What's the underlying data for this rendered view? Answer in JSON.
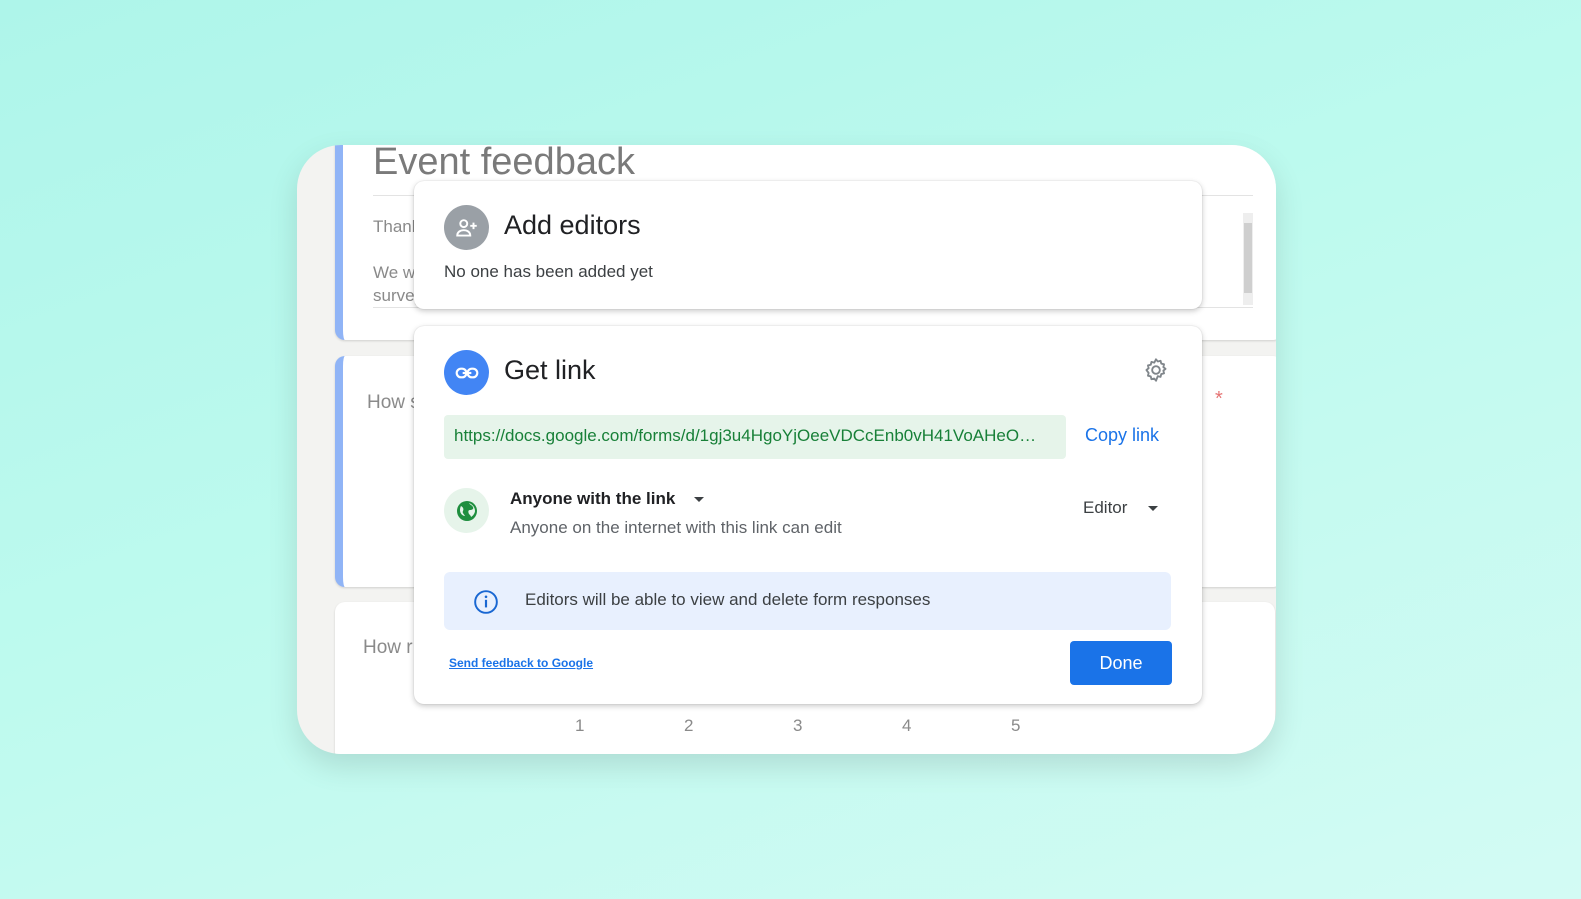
{
  "form": {
    "title": "Event feedback",
    "desc_line1": "Thank",
    "desc_line2a": "We wa",
    "desc_line2b": "survey",
    "question1": "How s",
    "question1_required": "*",
    "question2": "How r",
    "scale": [
      "1",
      "2",
      "3",
      "4",
      "5"
    ]
  },
  "add_editors": {
    "title": "Add editors",
    "subtitle": "No one has been added yet",
    "icon": "person-add-icon"
  },
  "get_link": {
    "title": "Get link",
    "icon": "link-icon",
    "settings_icon": "gear-icon",
    "url": "https://docs.google.com/forms/d/1gj3u4HgoYjOeeVDCcEnb0vH41VoAHeO…",
    "copy_label": "Copy link",
    "access_label": "Anyone with the link",
    "access_desc": "Anyone on the internet with this link can edit",
    "role_label": "Editor",
    "info_text": "Editors will be able to view and delete form responses",
    "feedback_label": "Send feedback to Google",
    "done_label": "Done"
  },
  "colors": {
    "accent": "#1a73e8",
    "link_green": "#188038",
    "link_bg": "#e6f4ea",
    "info_bg": "#e8f0fe",
    "globe_green": "#1e8e3e"
  }
}
